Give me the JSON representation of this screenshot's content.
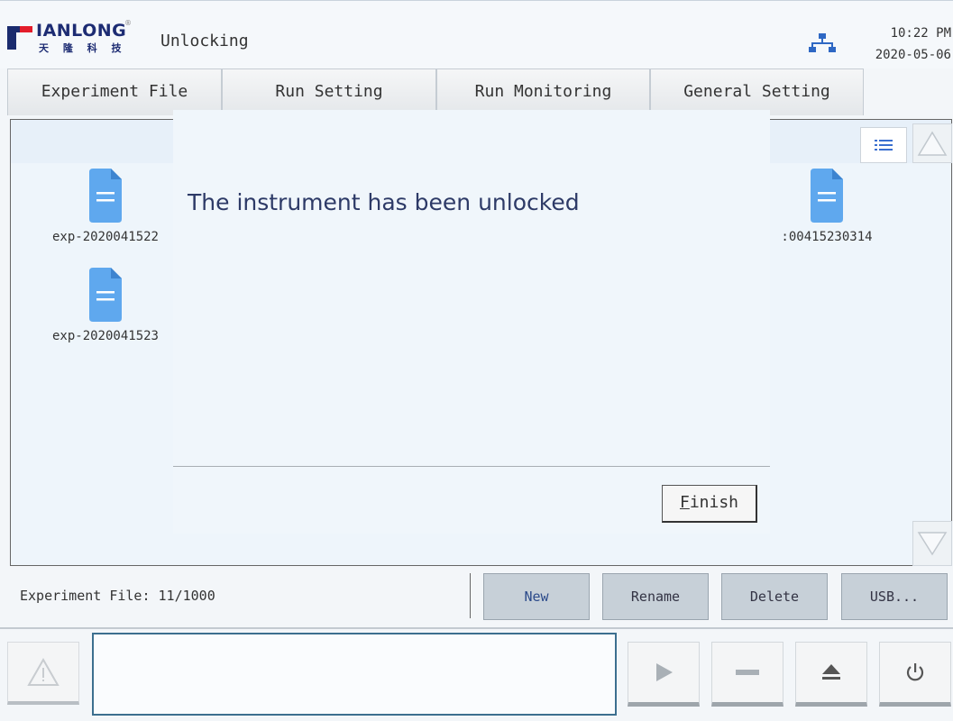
{
  "header": {
    "brand": "IANLONG",
    "brand_cn": "天 隆 科 技",
    "registered": "®",
    "title": "Unlocking",
    "time": "10:22 PM",
    "date": "2020-05-06"
  },
  "tabs": [
    {
      "label": "Experiment File"
    },
    {
      "label": "Run Setting"
    },
    {
      "label": "Run Monitoring"
    },
    {
      "label": "General Setting"
    }
  ],
  "files": [
    {
      "name": "exp-2020041522",
      "icon": "document-icon"
    },
    {
      "name": "exp-2020041523",
      "icon": "document-icon"
    },
    {
      "name": ":00415230314",
      "icon": "document-icon"
    }
  ],
  "dialog": {
    "message": "The instrument has been unlocked",
    "finish_first": "F",
    "finish_rest": "inish"
  },
  "toolbar": {
    "file_count": "Experiment File: 11/1000",
    "new": "New",
    "rename": "Rename",
    "delete": "Delete",
    "usb": "USB..."
  },
  "controls": [
    "warning-icon",
    "play-icon",
    "stop-icon",
    "eject-icon",
    "power-icon"
  ],
  "colors": {
    "brand_blue": "#1d2c73",
    "brand_red": "#e31d2b",
    "file_icon": "#5fa8ee",
    "dialog_text": "#2d3a67"
  }
}
